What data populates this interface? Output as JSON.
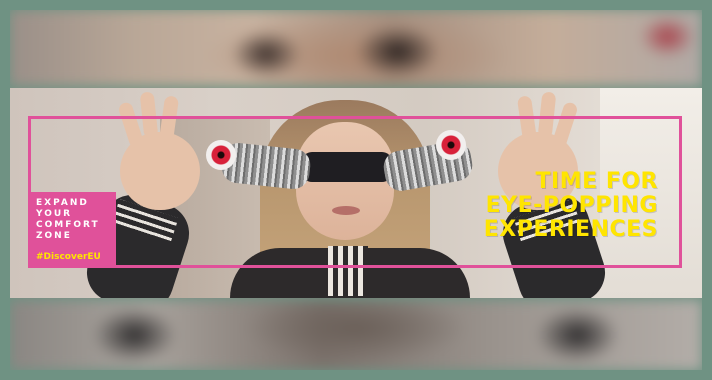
{
  "banner": {
    "headline": [
      "TIME FOR",
      "EYE-POPPING",
      "EXPERIENCES"
    ],
    "tag_lines": [
      "EXPAND",
      "YOUR",
      "COMFORT",
      "ZONE"
    ],
    "hashtag": "#DiscoverEU"
  },
  "colors": {
    "frame_background": "#6f9283",
    "accent_pink": "#e0519a",
    "headline_yellow": "#ffe500",
    "tag_text": "#ffffff"
  }
}
